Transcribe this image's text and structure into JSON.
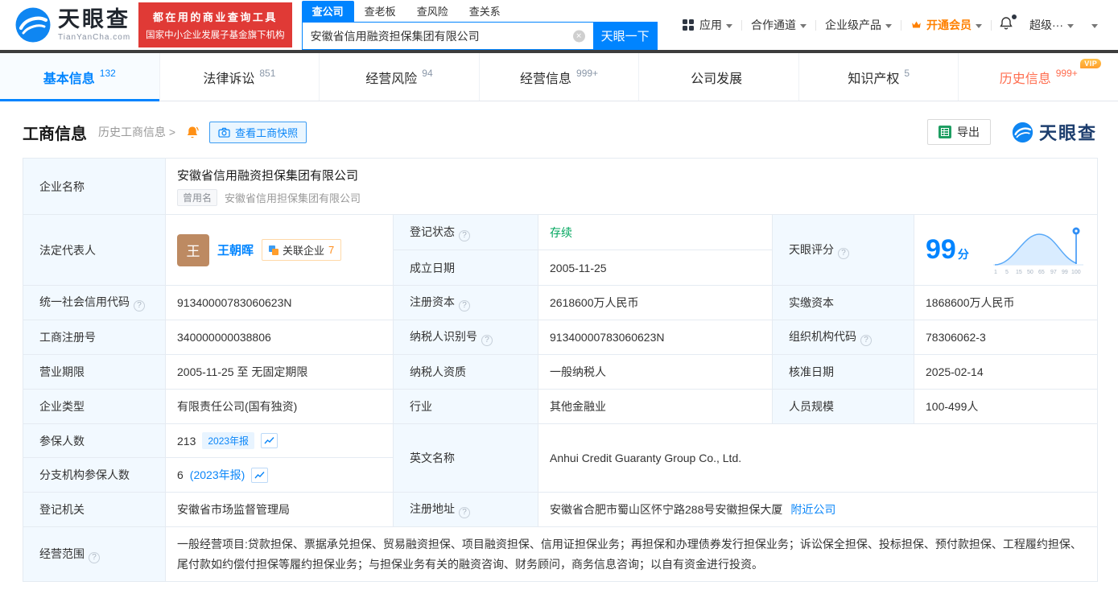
{
  "colors": {
    "accent_blue": "#0084ff",
    "status_green": "#00a65e",
    "vip_orange": "#ff8000",
    "promo_red": "#e03a36",
    "history_tab_red": "#ff6d4f",
    "label_cell_bg": "#f2f9ff"
  },
  "icons": {
    "logo-wave-icon": "blue-wave-circle",
    "apps-icon": "grid-2x2",
    "caret-down-icon": "triangle-down",
    "crown-icon": "orange-crown",
    "bell-icon": "bell",
    "clear-icon": "circle-x",
    "camera-icon": "camera",
    "excel-icon": "green-spreadsheet",
    "help-icon": "question-circle",
    "trend-icon": "line-chart",
    "score-pin-icon": "pin-marker"
  },
  "header": {
    "logo_title": "天眼查",
    "logo_subtitle": "TianYanCha.com",
    "promo_line1": "都在用的商业查询工具",
    "promo_line2": "国家中小企业发展子基金旗下机构",
    "search_tabs": [
      {
        "label": "查公司",
        "active": true
      },
      {
        "label": "查老板",
        "active": false
      },
      {
        "label": "查风险",
        "active": false
      },
      {
        "label": "查关系",
        "active": false
      }
    ],
    "search_value": "安徽省信用融资担保集团有限公司",
    "search_button": "天眼一下",
    "nav": {
      "app": "应用",
      "coop": "合作通道",
      "enterprise": "企业级产品",
      "vip": "开通会员",
      "super": "超级···"
    }
  },
  "tabs": [
    {
      "label": "基本信息",
      "count": "132"
    },
    {
      "label": "法律诉讼",
      "count": "851"
    },
    {
      "label": "经营风险",
      "count": "94"
    },
    {
      "label": "经营信息",
      "count": "999+"
    },
    {
      "label": "公司发展",
      "count": ""
    },
    {
      "label": "知识产权",
      "count": "5"
    },
    {
      "label": "历史信息",
      "count": "999+",
      "vip_badge": "VIP"
    }
  ],
  "toolbar": {
    "title": "工商信息",
    "history_link": "历史工商信息 >",
    "snapshot_button": "查看工商快照",
    "export_button": "导出",
    "brand": "天眼查"
  },
  "info": {
    "company_name": {
      "label": "企业名称",
      "value": "安徽省信用融资担保集团有限公司",
      "former_tag": "曾用名",
      "former_value": "安徽省信用担保集团有限公司"
    },
    "legal_rep": {
      "label": "法定代表人",
      "avatar": "王",
      "name": "王朝晖",
      "related_label": "关联企业",
      "related_count": "7"
    },
    "reg_status": {
      "label": "登记状态",
      "value": "存续"
    },
    "score": {
      "label": "天眼评分",
      "value": "99",
      "unit": "分",
      "ticks": [
        "1",
        "5",
        "15",
        "50",
        "65",
        "97",
        "99",
        "100"
      ]
    },
    "establish_date": {
      "label": "成立日期",
      "value": "2005-11-25"
    },
    "credit_code": {
      "label": "统一社会信用代码",
      "value": "91340000783060623N"
    },
    "reg_capital": {
      "label": "注册资本",
      "value": "2618600万人民币"
    },
    "paid_capital": {
      "label": "实缴资本",
      "value": "1868600万人民币"
    },
    "reg_number": {
      "label": "工商注册号",
      "value": "340000000038806"
    },
    "taxpayer_id": {
      "label": "纳税人识别号",
      "value": "91340000783060623N"
    },
    "org_code": {
      "label": "组织机构代码",
      "value": "78306062-3"
    },
    "business_term": {
      "label": "营业期限",
      "value": "2005-11-25 至 无固定期限"
    },
    "taxpayer_quality": {
      "label": "纳税人资质",
      "value": "一般纳税人"
    },
    "approval_date": {
      "label": "核准日期",
      "value": "2025-02-14"
    },
    "company_type": {
      "label": "企业类型",
      "value": "有限责任公司(国有独资)"
    },
    "industry": {
      "label": "行业",
      "value": "其他金融业"
    },
    "staff_size": {
      "label": "人员规模",
      "value": "100-499人"
    },
    "insured_count": {
      "label": "参保人数",
      "value": "213",
      "report_badge": "2023年报"
    },
    "english_name": {
      "label": "英文名称",
      "value": "Anhui Credit Guaranty Group Co., Ltd."
    },
    "branch_insured": {
      "label": "分支机构参保人数",
      "value": "6",
      "report_link": "(2023年报)"
    },
    "reg_authority": {
      "label": "登记机关",
      "value": "安徽省市场监督管理局"
    },
    "reg_address": {
      "label": "注册地址",
      "value": "安徽省合肥市蜀山区怀宁路288号安徽担保大厦",
      "nearby_link": "附近公司"
    },
    "business_scope": {
      "label": "经营范围",
      "value": "一般经营项目:贷款担保、票据承兑担保、贸易融资担保、项目融资担保、信用证担保业务；再担保和办理债券发行担保业务；诉讼保全担保、投标担保、预付款担保、工程履约担保、尾付款如约偿付担保等履约担保业务；与担保业务有关的融资咨询、财务顾问，商务信息咨询；以自有资金进行投资。"
    }
  }
}
